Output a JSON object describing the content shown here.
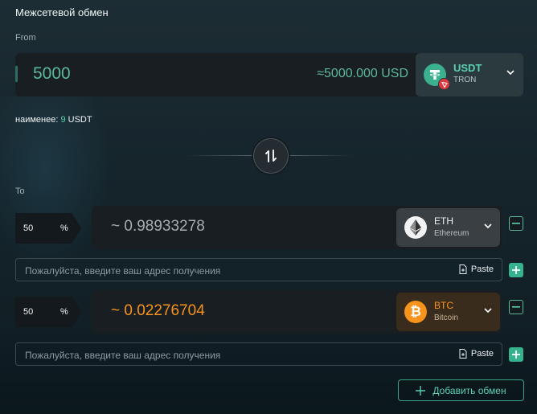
{
  "header": {
    "title": "Межсетевой обмен"
  },
  "from": {
    "label": "From",
    "amount": "5000",
    "usd_equiv": "≈5000.000 USD",
    "token": {
      "symbol": "USDT",
      "network": "TRON",
      "icon": "tether-icon",
      "badge_icon": "tron-badge-icon"
    },
    "minimum": {
      "prefix": "наименее:",
      "value": "9",
      "unit": "USDT"
    }
  },
  "swap": {
    "icon": "swap-arrows-icon"
  },
  "to": {
    "label": "To",
    "rows": [
      {
        "percent": "50",
        "percent_sign": "%",
        "amount": "~ 0.98933278",
        "token": {
          "symbol": "ETH",
          "network": "Ethereum",
          "icon": "ethereum-icon"
        },
        "address_placeholder": "Пожалуйста, введите ваш адрес получения",
        "paste_label": "Paste"
      },
      {
        "percent": "50",
        "percent_sign": "%",
        "amount": "~ 0.02276704",
        "token": {
          "symbol": "BTC",
          "network": "Bitcoin",
          "icon": "bitcoin-icon"
        },
        "address_placeholder": "Пожалуйста, введите ваш адрес получения",
        "paste_label": "Paste"
      }
    ]
  },
  "add_exchange": {
    "label": "Добавить обмен",
    "icon": "plus-icon"
  },
  "colors": {
    "accent": "#5cd0b0",
    "accent_dim": "#5cb89c",
    "btc_orange": "#f7931a",
    "eth_text": "#a6adb1"
  }
}
